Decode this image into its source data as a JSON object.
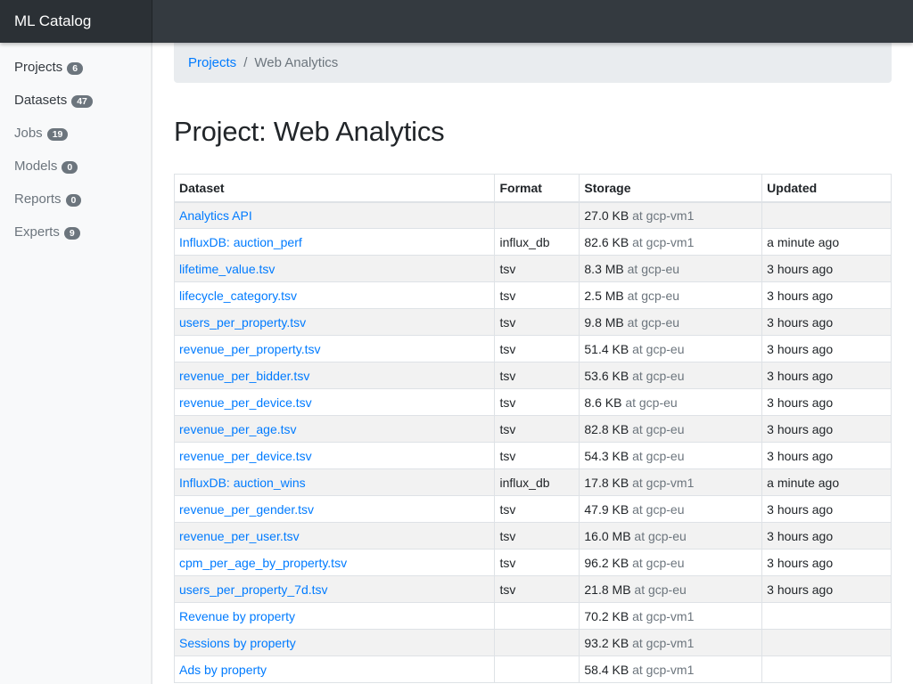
{
  "app": {
    "brand": "ML Catalog"
  },
  "sidebar": {
    "items": [
      {
        "label": "Projects",
        "count": "6",
        "strong": true
      },
      {
        "label": "Datasets",
        "count": "47",
        "strong": true
      },
      {
        "label": "Jobs",
        "count": "19",
        "strong": false
      },
      {
        "label": "Models",
        "count": "0",
        "strong": false
      },
      {
        "label": "Reports",
        "count": "0",
        "strong": false
      },
      {
        "label": "Experts",
        "count": "9",
        "strong": false
      }
    ]
  },
  "breadcrumb": {
    "parent": "Projects",
    "separator": "/",
    "current": "Web Analytics"
  },
  "page": {
    "title": "Project: Web Analytics"
  },
  "table": {
    "headers": [
      "Dataset",
      "Format",
      "Storage",
      "Updated"
    ],
    "rows": [
      {
        "name": "Analytics API",
        "format": "",
        "size": "27.0 KB",
        "location": "at gcp-vm1",
        "updated": ""
      },
      {
        "name": "InfluxDB: auction_perf",
        "format": "influx_db",
        "size": "82.6 KB",
        "location": "at gcp-vm1",
        "updated": "a minute ago"
      },
      {
        "name": "lifetime_value.tsv",
        "format": "tsv",
        "size": "8.3 MB",
        "location": "at gcp-eu",
        "updated": "3 hours ago"
      },
      {
        "name": "lifecycle_category.tsv",
        "format": "tsv",
        "size": "2.5 MB",
        "location": "at gcp-eu",
        "updated": "3 hours ago"
      },
      {
        "name": "users_per_property.tsv",
        "format": "tsv",
        "size": "9.8 MB",
        "location": "at gcp-eu",
        "updated": "3 hours ago"
      },
      {
        "name": "revenue_per_property.tsv",
        "format": "tsv",
        "size": "51.4 KB",
        "location": "at gcp-eu",
        "updated": "3 hours ago"
      },
      {
        "name": "revenue_per_bidder.tsv",
        "format": "tsv",
        "size": "53.6 KB",
        "location": "at gcp-eu",
        "updated": "3 hours ago"
      },
      {
        "name": "revenue_per_device.tsv",
        "format": "tsv",
        "size": "8.6 KB",
        "location": "at gcp-eu",
        "updated": "3 hours ago"
      },
      {
        "name": "revenue_per_age.tsv",
        "format": "tsv",
        "size": "82.8 KB",
        "location": "at gcp-eu",
        "updated": "3 hours ago"
      },
      {
        "name": "revenue_per_device.tsv",
        "format": "tsv",
        "size": "54.3 KB",
        "location": "at gcp-eu",
        "updated": "3 hours ago"
      },
      {
        "name": "InfluxDB: auction_wins",
        "format": "influx_db",
        "size": "17.8 KB",
        "location": "at gcp-vm1",
        "updated": "a minute ago"
      },
      {
        "name": "revenue_per_gender.tsv",
        "format": "tsv",
        "size": "47.9 KB",
        "location": "at gcp-eu",
        "updated": "3 hours ago"
      },
      {
        "name": "revenue_per_user.tsv",
        "format": "tsv",
        "size": "16.0 MB",
        "location": "at gcp-eu",
        "updated": "3 hours ago"
      },
      {
        "name": "cpm_per_age_by_property.tsv",
        "format": "tsv",
        "size": "96.2 KB",
        "location": "at gcp-eu",
        "updated": "3 hours ago"
      },
      {
        "name": "users_per_property_7d.tsv",
        "format": "tsv",
        "size": "21.8 MB",
        "location": "at gcp-eu",
        "updated": "3 hours ago"
      },
      {
        "name": "Revenue by property",
        "format": "",
        "size": "70.2 KB",
        "location": "at gcp-vm1",
        "updated": ""
      },
      {
        "name": "Sessions by property",
        "format": "",
        "size": "93.2 KB",
        "location": "at gcp-vm1",
        "updated": ""
      },
      {
        "name": "Ads by property",
        "format": "",
        "size": "58.4 KB",
        "location": "at gcp-vm1",
        "updated": ""
      }
    ]
  }
}
